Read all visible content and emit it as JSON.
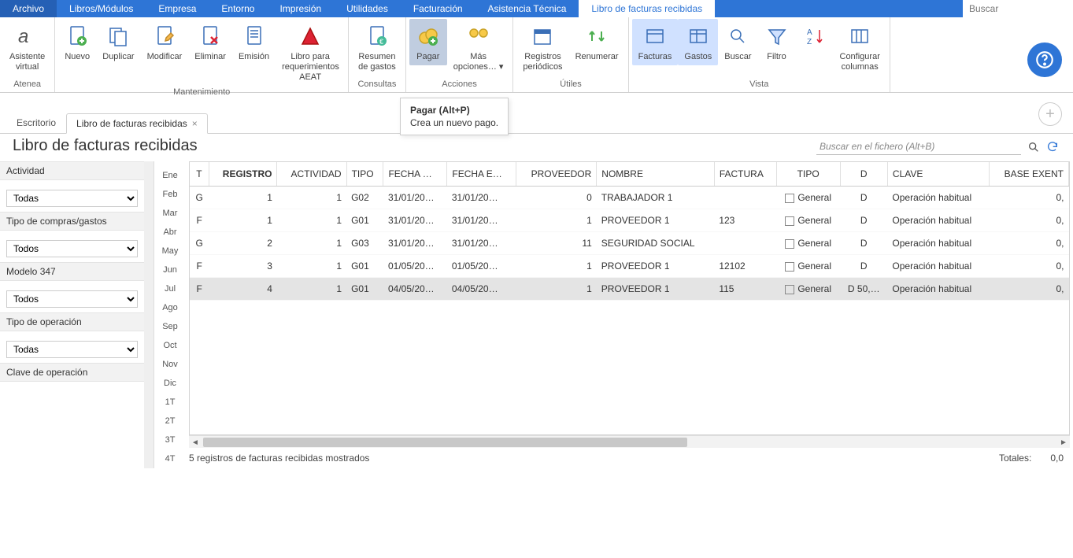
{
  "menubar": {
    "items": [
      "Archivo",
      "Libros/Módulos",
      "Empresa",
      "Entorno",
      "Impresión",
      "Utilidades",
      "Facturación",
      "Asistencia Técnica",
      "Libro de facturas recibidas"
    ],
    "active_index": 8,
    "search_placeholder": "Buscar"
  },
  "ribbon": {
    "groups": [
      {
        "label": "Atenea",
        "buttons": [
          {
            "key": "asistente",
            "label": "Asistente\nvirtual"
          }
        ]
      },
      {
        "label": "Mantenimiento",
        "buttons": [
          {
            "key": "nuevo",
            "label": "Nuevo"
          },
          {
            "key": "duplicar",
            "label": "Duplicar"
          },
          {
            "key": "modificar",
            "label": "Modificar"
          },
          {
            "key": "eliminar",
            "label": "Eliminar"
          },
          {
            "key": "emision",
            "label": "Emisión"
          },
          {
            "key": "libro-aeat",
            "label": "Libro para\nrequerimientos AEAT"
          }
        ]
      },
      {
        "label": "Consultas",
        "buttons": [
          {
            "key": "resumen-gastos",
            "label": "Resumen\nde gastos"
          }
        ]
      },
      {
        "label": "Acciones",
        "buttons": [
          {
            "key": "pagar",
            "label": "Pagar",
            "pressed": true
          },
          {
            "key": "mas-opciones",
            "label": "Más\nopciones… ▾"
          }
        ]
      },
      {
        "label": "Útiles",
        "buttons": [
          {
            "key": "registros-periodicos",
            "label": "Registros\nperiódicos"
          },
          {
            "key": "renumerar",
            "label": "Renumerar"
          }
        ]
      },
      {
        "label": "Vista",
        "buttons": [
          {
            "key": "facturas",
            "label": "Facturas",
            "active": true
          },
          {
            "key": "gastos",
            "label": "Gastos",
            "active": true
          },
          {
            "key": "buscar",
            "label": "Buscar"
          },
          {
            "key": "filtro",
            "label": "Filtro"
          },
          {
            "key": "orden",
            "label": ""
          },
          {
            "key": "config-col",
            "label": "Configurar\ncolumnas"
          }
        ]
      }
    ]
  },
  "tooltip": {
    "title": "Pagar (Alt+P)",
    "body": "Crea un nuevo pago."
  },
  "doc_tabs": {
    "items": [
      {
        "label": "Escritorio",
        "active": false,
        "closable": false
      },
      {
        "label": "Libro de facturas recibidas",
        "active": true,
        "closable": true
      }
    ]
  },
  "page_title": "Libro de facturas recibidas",
  "filters": [
    {
      "label": "Actividad",
      "value": "Todas"
    },
    {
      "label": "Tipo de compras/gastos",
      "value": "Todos"
    },
    {
      "label": "Modelo 347",
      "value": "Todos"
    },
    {
      "label": "Tipo de operación",
      "value": "Todas"
    },
    {
      "label": "Clave de operación",
      "value": ""
    }
  ],
  "months": [
    "Ene",
    "Feb",
    "Mar",
    "Abr",
    "May",
    "Jun",
    "Jul",
    "Ago",
    "Sep",
    "Oct",
    "Nov",
    "Dic",
    "1T",
    "2T",
    "3T",
    "4T"
  ],
  "grid": {
    "search_placeholder": "Buscar en el fichero (Alt+B)",
    "columns": [
      "T",
      "REGISTRO",
      "ACTIVIDAD",
      "TIPO",
      "FECHA …",
      "FECHA E…",
      "PROVEEDOR",
      "NOMBRE",
      "FACTURA",
      "TIPO",
      "D",
      "CLAVE",
      "BASE EXENT"
    ],
    "rows": [
      {
        "t": "G",
        "registro": "1",
        "actividad": "1",
        "tipo": "G02",
        "fecha": "31/01/20…",
        "fecha_e": "31/01/20…",
        "proveedor": "0",
        "nombre": "TRABAJADOR 1",
        "factura": "",
        "tipo2": "General",
        "d": "D",
        "clave": "Operación habitual",
        "base": "0,"
      },
      {
        "t": "F",
        "registro": "1",
        "actividad": "1",
        "tipo": "G01",
        "fecha": "31/01/20…",
        "fecha_e": "31/01/20…",
        "proveedor": "1",
        "nombre": "PROVEEDOR 1",
        "factura": "123",
        "tipo2": "General",
        "d": "D",
        "clave": "Operación habitual",
        "base": "0,"
      },
      {
        "t": "G",
        "registro": "2",
        "actividad": "1",
        "tipo": "G03",
        "fecha": "31/01/20…",
        "fecha_e": "31/01/20…",
        "proveedor": "11",
        "nombre": "SEGURIDAD SOCIAL",
        "factura": "",
        "tipo2": "General",
        "d": "D",
        "clave": "Operación habitual",
        "base": "0,"
      },
      {
        "t": "F",
        "registro": "3",
        "actividad": "1",
        "tipo": "G01",
        "fecha": "01/05/20…",
        "fecha_e": "01/05/20…",
        "proveedor": "1",
        "nombre": "PROVEEDOR 1",
        "factura": "12102",
        "tipo2": "General",
        "d": "D",
        "clave": "Operación habitual",
        "base": "0,"
      },
      {
        "t": "F",
        "registro": "4",
        "actividad": "1",
        "tipo": "G01",
        "fecha": "04/05/20…",
        "fecha_e": "04/05/20…",
        "proveedor": "1",
        "nombre": "PROVEEDOR 1",
        "factura": "115",
        "tipo2": "General",
        "d": "D 50,…",
        "clave": "Operación habitual",
        "base": "0,",
        "selected": true
      }
    ]
  },
  "footer": {
    "count_text": "5 registros de facturas recibidas mostrados",
    "totals_label": "Totales:",
    "totals_value": "0,0"
  }
}
